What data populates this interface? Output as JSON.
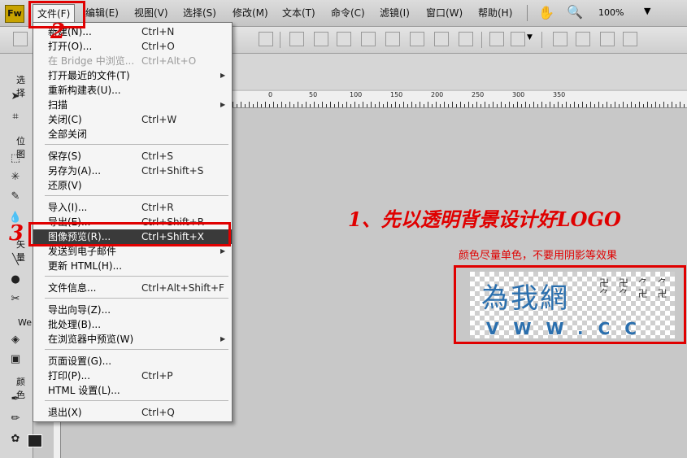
{
  "menubar": {
    "app_logo": "Fw",
    "items": [
      "文件(F)",
      "编辑(E)",
      "视图(V)",
      "选择(S)",
      "修改(M)",
      "文本(T)",
      "命令(C)",
      "滤镜(I)",
      "窗口(W)",
      "帮助(H)"
    ],
    "zoom": "100%"
  },
  "tools_panel": {
    "labels": [
      "选择",
      "位图",
      "矢量",
      "Web",
      "颜色"
    ]
  },
  "file_menu": {
    "items": [
      {
        "label": "新建(N)...",
        "shortcut": "Ctrl+N"
      },
      {
        "label": "打开(O)...",
        "shortcut": "Ctrl+O"
      },
      {
        "label": "在 Bridge 中浏览...",
        "shortcut": "Ctrl+Alt+O"
      },
      {
        "label": "打开最近的文件(T)",
        "shortcut": ""
      },
      {
        "label": "重新构建表(U)...",
        "shortcut": ""
      },
      {
        "label": "扫描",
        "shortcut": ""
      },
      {
        "label": "关闭(C)",
        "shortcut": "Ctrl+W"
      },
      {
        "label": "全部关闭",
        "shortcut": ""
      },
      {
        "label": "保存(S)",
        "shortcut": "Ctrl+S"
      },
      {
        "label": "另存为(A)...",
        "shortcut": "Ctrl+Shift+S"
      },
      {
        "label": "还原(V)",
        "shortcut": ""
      },
      {
        "label": "导入(I)...",
        "shortcut": "Ctrl+R"
      },
      {
        "label": "导出(E)...",
        "shortcut": "Ctrl+Shift+R"
      },
      {
        "label": "图像预览(R)...",
        "shortcut": "Ctrl+Shift+X"
      },
      {
        "label": "发送到电子邮件",
        "shortcut": ""
      },
      {
        "label": "更新 HTML(H)...",
        "shortcut": ""
      },
      {
        "label": "文件信息...",
        "shortcut": "Ctrl+Alt+Shift+F"
      },
      {
        "label": "导出向导(Z)...",
        "shortcut": ""
      },
      {
        "label": "批处理(B)...",
        "shortcut": ""
      },
      {
        "label": "在浏览器中预览(W)",
        "shortcut": ""
      },
      {
        "label": "页面设置(G)...",
        "shortcut": ""
      },
      {
        "label": "打印(P)...",
        "shortcut": "Ctrl+P"
      },
      {
        "label": "HTML 设置(L)...",
        "shortcut": ""
      },
      {
        "label": "退出(X)",
        "shortcut": "Ctrl+Q"
      }
    ]
  },
  "ruler": {
    "labels": [
      "0",
      "50",
      "100",
      "150",
      "200",
      "250",
      "300",
      "350"
    ]
  },
  "annotations": {
    "step2": "2",
    "step3": "3",
    "heading": "1、先以透明背景设计好LOGO",
    "subtext": "颜色尽量单色，不要用阴影等效果",
    "accent_color": "#e00000"
  },
  "logo_preview": {
    "title": "為我網",
    "url": "VWW.CC"
  }
}
